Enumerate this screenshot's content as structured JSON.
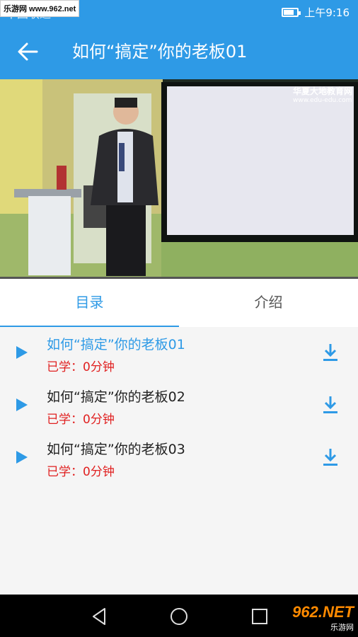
{
  "status_bar": {
    "carrier": "中国联通",
    "time": "上午9:16",
    "watermark": "乐游网 www.962.net"
  },
  "app_bar": {
    "title": "如何“搞定”你的老板01",
    "back_icon": "arrow-left-icon"
  },
  "video": {
    "logo_name": "华夏大地教育网",
    "logo_url": "www.edu-edu.com",
    "progress_fraction": 0.0
  },
  "tabs": [
    {
      "label": "目录",
      "active": true
    },
    {
      "label": "介绍",
      "active": false
    }
  ],
  "lessons": [
    {
      "title": "如何“搞定”你的老板01",
      "progress": "已学：0分钟",
      "active": true
    },
    {
      "title": "如何“搞定”你的老板02",
      "progress": "已学：0分钟",
      "active": false
    },
    {
      "title": "如何“搞定”你的老板03",
      "progress": "已学：0分钟",
      "active": false
    }
  ],
  "nav_bar": {
    "icons": [
      "back-triangle-icon",
      "home-circle-icon",
      "recents-square-icon"
    ],
    "corner_mark_big": "962.NET",
    "corner_mark_small": "乐游网"
  },
  "colors": {
    "accent": "#2e9ae6",
    "progress_text": "#e02020"
  }
}
